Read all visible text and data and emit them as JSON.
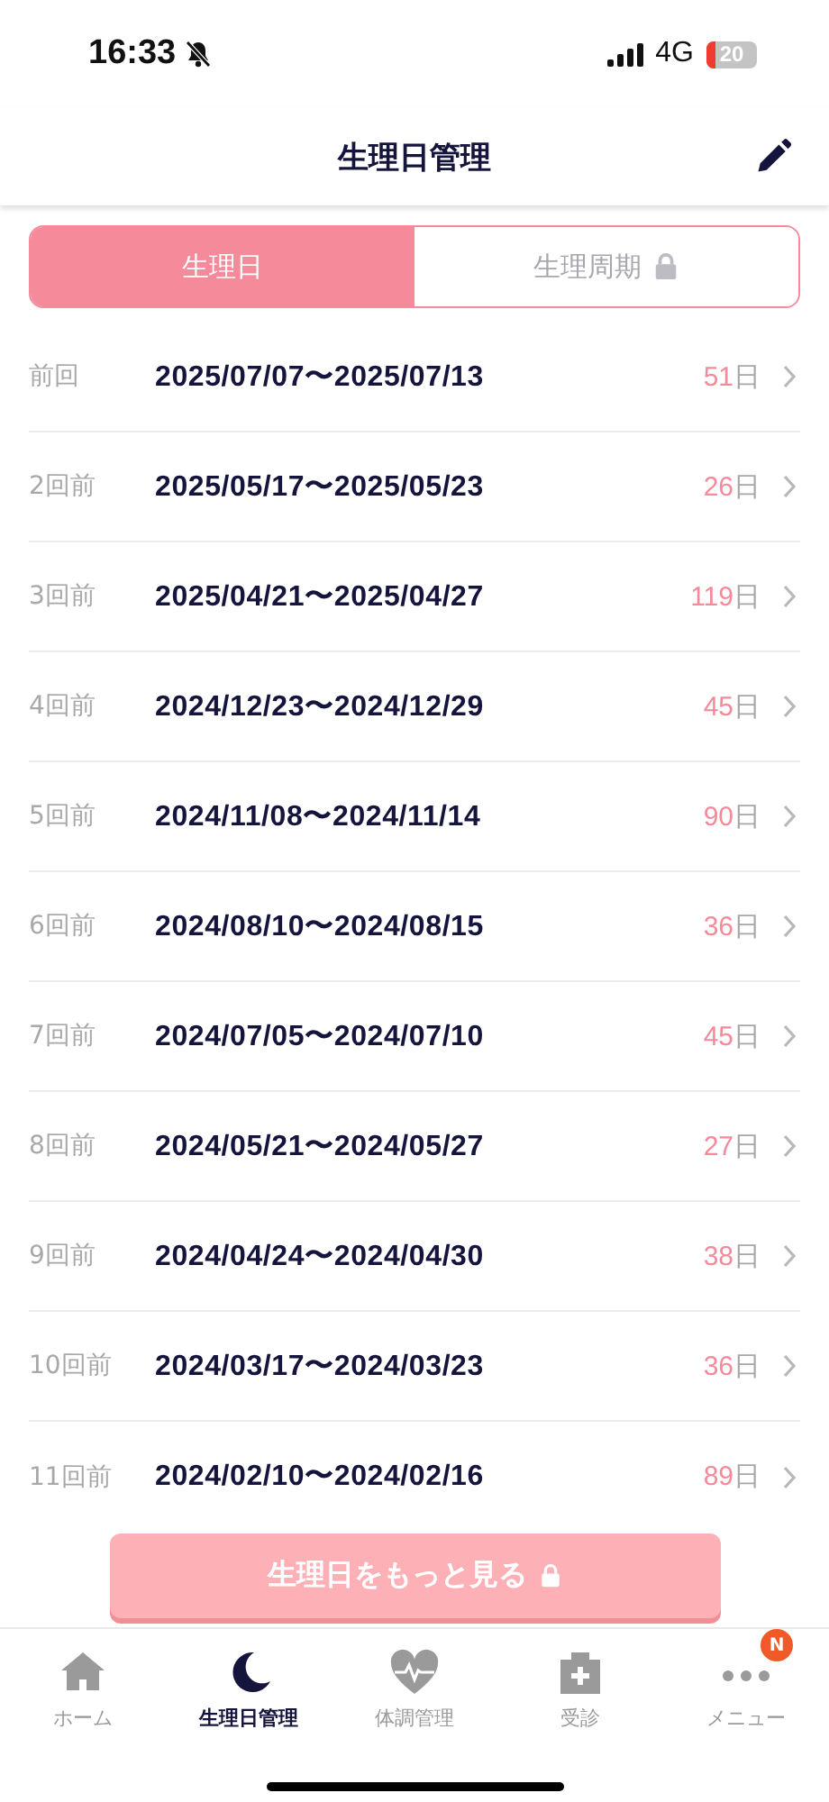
{
  "status_bar": {
    "time": "16:33",
    "network": "4G",
    "battery": "20"
  },
  "header": {
    "title": "生理日管理"
  },
  "tabs": [
    {
      "label": "生理日",
      "selected": true,
      "locked": false
    },
    {
      "label": "生理周期",
      "selected": false,
      "locked": true
    }
  ],
  "periods": [
    {
      "label": "前回",
      "range": "2025/07/07〜2025/07/13",
      "days": "51",
      "unit": "日"
    },
    {
      "label": "2回前",
      "range": "2025/05/17〜2025/05/23",
      "days": "26",
      "unit": "日"
    },
    {
      "label": "3回前",
      "range": "2025/04/21〜2025/04/27",
      "days": "119",
      "unit": "日"
    },
    {
      "label": "4回前",
      "range": "2024/12/23〜2024/12/29",
      "days": "45",
      "unit": "日"
    },
    {
      "label": "5回前",
      "range": "2024/11/08〜2024/11/14",
      "days": "90",
      "unit": "日"
    },
    {
      "label": "6回前",
      "range": "2024/08/10〜2024/08/15",
      "days": "36",
      "unit": "日"
    },
    {
      "label": "7回前",
      "range": "2024/07/05〜2024/07/10",
      "days": "45",
      "unit": "日"
    },
    {
      "label": "8回前",
      "range": "2024/05/21〜2024/05/27",
      "days": "27",
      "unit": "日"
    },
    {
      "label": "9回前",
      "range": "2024/04/24〜2024/04/30",
      "days": "38",
      "unit": "日"
    },
    {
      "label": "10回前",
      "range": "2024/03/17〜2024/03/23",
      "days": "36",
      "unit": "日"
    },
    {
      "label": "11回前",
      "range": "2024/02/10〜2024/02/16",
      "days": "89",
      "unit": "日"
    }
  ],
  "more_button": {
    "label": "生理日をもっと見る",
    "locked": true
  },
  "tab_bar": [
    {
      "label": "ホーム",
      "kind": "home",
      "selected": false
    },
    {
      "label": "生理日管理",
      "kind": "moon",
      "selected": true
    },
    {
      "label": "体調管理",
      "kind": "heart",
      "selected": false
    },
    {
      "label": "受診",
      "kind": "clinic",
      "selected": false
    },
    {
      "label": "メニュー",
      "kind": "dots",
      "selected": false,
      "badge": "N"
    }
  ]
}
